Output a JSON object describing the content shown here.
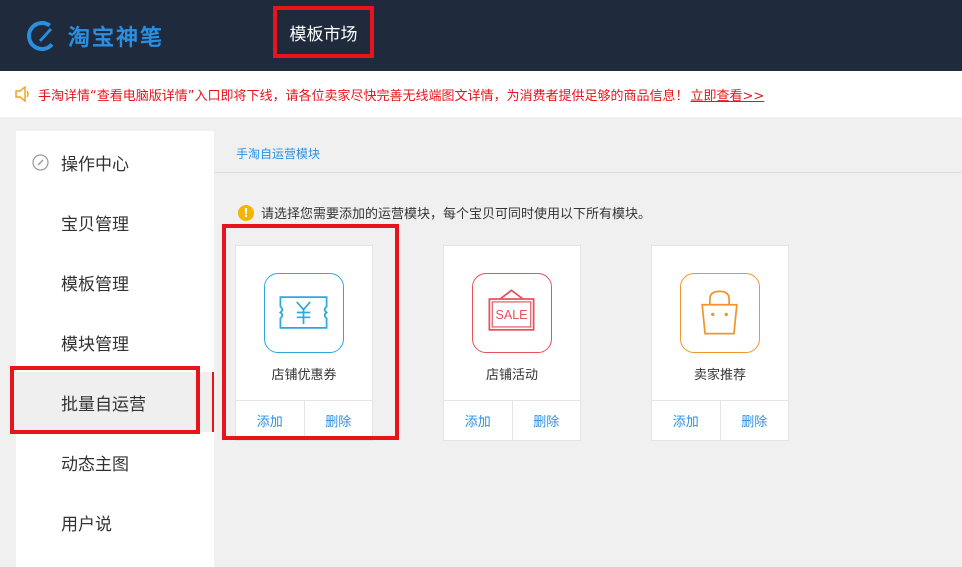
{
  "header": {
    "logo_text": "淘宝神笔",
    "nav_tab": "模板市场"
  },
  "notice": {
    "text": "手淘详情“查看电脑版详情”入口即将下线，请各位卖家尽快完善无线端图文详情，为消费者提供足够的商品信息！",
    "link": "立即查看>>"
  },
  "sidebar": {
    "items": [
      {
        "label": "操作中心"
      },
      {
        "label": "宝贝管理"
      },
      {
        "label": "模板管理"
      },
      {
        "label": "模块管理"
      },
      {
        "label": "批量自运营"
      },
      {
        "label": "动态主图"
      },
      {
        "label": "用户说"
      }
    ]
  },
  "main": {
    "section_title": "手淘自运营模块",
    "hint_icon": "!",
    "hint": "请选择您需要添加的运营模块，每个宝贝可同时使用以下所有模块。",
    "cards": [
      {
        "label": "店铺优惠券",
        "icon": "coupon-icon",
        "color": "#2fa8e0",
        "add": "添加",
        "delete": "删除"
      },
      {
        "label": "店铺活动",
        "icon": "sale-sign-icon",
        "color": "#e8505b",
        "sale_text": "SALE",
        "add": "添加",
        "delete": "删除"
      },
      {
        "label": "卖家推荐",
        "icon": "shopping-bag-icon",
        "color": "#f0952a",
        "add": "添加",
        "delete": "删除"
      }
    ]
  },
  "colors": {
    "header_bg": "#1f2a3c",
    "brand_blue": "#2b8fe0",
    "highlight_red": "#e8141b"
  }
}
